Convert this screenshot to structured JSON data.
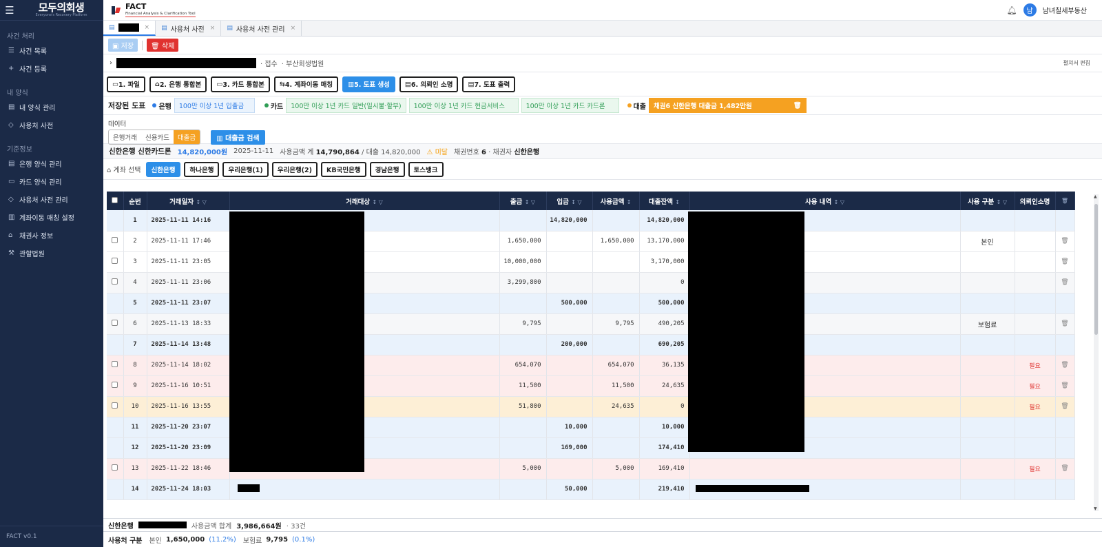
{
  "sidebar": {
    "logo_main": "모두의회생",
    "logo_sub": "Everyone's Recovery Platform",
    "sections": [
      {
        "title": "사건 처리",
        "items": [
          {
            "icon": "list-icon",
            "label": "사건 목록"
          },
          {
            "icon": "plus-icon",
            "label": "사건 등록"
          }
        ]
      },
      {
        "title": "내 양식",
        "items": [
          {
            "icon": "document-icon",
            "label": "내 양식 관리"
          },
          {
            "icon": "tag-icon",
            "label": "사용처 사전"
          }
        ]
      },
      {
        "title": "기준정보",
        "items": [
          {
            "icon": "document-icon",
            "label": "은행 양식 관리"
          },
          {
            "icon": "card-icon",
            "label": "카드 양식 관리"
          },
          {
            "icon": "tag-icon",
            "label": "사용처 사전 관리"
          },
          {
            "icon": "chart-icon",
            "label": "계좌이동 매칭 설정"
          },
          {
            "icon": "bank-icon",
            "label": "채권사 정보"
          },
          {
            "icon": "gavel-icon",
            "label": "관할법원"
          }
        ]
      }
    ],
    "version": "FACT v0.1"
  },
  "header": {
    "title": "FACT",
    "subtitle": "Financial Analysis & Clarification Tool",
    "avatar_initial": "남",
    "user_name": "남녀칠세부동산"
  },
  "tabs": [
    {
      "label": "",
      "redacted": true
    },
    {
      "label": "사용처 사전"
    },
    {
      "label": "사용처 사전 관리"
    }
  ],
  "actions": {
    "save": "저장",
    "delete": "삭제"
  },
  "case": {
    "status": "· 접수",
    "court": "· 부산회생법원",
    "edit": "펼쳐서 편집"
  },
  "steps": [
    "1. 파일",
    "2. 은행 통합본",
    "3. 카드 통합본",
    "4. 계좌이동 매칭",
    "5. 도표 생성",
    "6. 의뢰인 소명",
    "7. 도표 출력"
  ],
  "saved": {
    "label": "저장된 도표",
    "bank_label": "은행",
    "bank_chips": [
      "100만 이상 1년 입출금"
    ],
    "card_label": "카드",
    "card_chips": [
      "100만 이상 1년 카드 일반(일시불·할부)",
      "100만 이상 1년 카드 현금서비스",
      "100만 이상 1년 카드 카드론"
    ],
    "loan_label": "대출",
    "loan_chip": "채권6 신한은행 대출금 1,482만원",
    "colors": {
      "bank": "#2d7be5",
      "card": "#2f9d55",
      "loan": "#f5a121"
    }
  },
  "data_filter": {
    "label": "데이터",
    "options": [
      "은행거래",
      "신용카드",
      "대출금"
    ],
    "selected": "대출금",
    "search_button": "대출금 검색"
  },
  "summary": {
    "title": "신한은행 신한카드론",
    "amount": "14,820,000원",
    "date": "2025-11-11",
    "usage_label": "사용금액 계",
    "usage_value": "14,790,864",
    "loan_label": "/ 대출",
    "loan_value": "14,820,000",
    "warning": "미달",
    "bond_no_label": "채권번호",
    "bond_no": "6",
    "creditor_label": "· 채권자",
    "creditor": "신한은행"
  },
  "accounts": {
    "label": "계좌 선택",
    "items": [
      "신한은행",
      "하나은행",
      "우리은행(1)",
      "우리은행(2)",
      "KB국민은행",
      "경남은행",
      "토스뱅크"
    ],
    "selected": "신한은행"
  },
  "table": {
    "columns": [
      "순번",
      "거래일자",
      "거래대상",
      "출금",
      "입금",
      "사용금액",
      "대출잔액",
      "사용 내역",
      "사용 구분",
      "의뢰인소명"
    ],
    "rows": [
      {
        "no": "1",
        "date": "2025-11-11 14:16",
        "out": "",
        "in": "14,820,000",
        "used": "",
        "balance": "14,820,000",
        "cat": "",
        "need": "",
        "style": "blue",
        "check": false
      },
      {
        "no": "2",
        "date": "2025-11-11 17:46",
        "out": "1,650,000",
        "in": "",
        "used": "1,650,000",
        "balance": "13,170,000",
        "cat": "본인",
        "need": "",
        "style": "white",
        "check": true
      },
      {
        "no": "3",
        "date": "2025-11-11 23:05",
        "out": "10,000,000",
        "in": "",
        "used": "",
        "balance": "3,170,000",
        "cat": "",
        "need": "",
        "style": "white",
        "check": true
      },
      {
        "no": "4",
        "date": "2025-11-11 23:06",
        "out": "3,299,800",
        "in": "",
        "used": "",
        "balance": "0",
        "cat": "",
        "need": "",
        "style": "grey",
        "check": true
      },
      {
        "no": "5",
        "date": "2025-11-11 23:07",
        "out": "",
        "in": "500,000",
        "used": "",
        "balance": "500,000",
        "cat": "",
        "need": "",
        "style": "blue",
        "check": false
      },
      {
        "no": "6",
        "date": "2025-11-13 18:33",
        "out": "9,795",
        "in": "",
        "used": "9,795",
        "balance": "490,205",
        "cat": "보험료",
        "need": "",
        "style": "grey",
        "check": true
      },
      {
        "no": "7",
        "date": "2025-11-14 13:48",
        "out": "",
        "in": "200,000",
        "used": "",
        "balance": "690,205",
        "cat": "",
        "need": "",
        "style": "blue",
        "check": false
      },
      {
        "no": "8",
        "date": "2025-11-14 18:02",
        "out": "654,070",
        "in": "",
        "used": "654,070",
        "balance": "36,135",
        "cat": "",
        "need": "필요",
        "style": "pink",
        "check": true
      },
      {
        "no": "9",
        "date": "2025-11-16 10:51",
        "out": "11,500",
        "in": "",
        "used": "11,500",
        "balance": "24,635",
        "cat": "",
        "need": "필요",
        "style": "pink",
        "check": true
      },
      {
        "no": "10",
        "date": "2025-11-16 13:55",
        "out": "51,800",
        "in": "",
        "used": "24,635",
        "balance": "0",
        "cat": "",
        "need": "필요",
        "style": "orange",
        "check": true
      },
      {
        "no": "11",
        "date": "2025-11-20 23:07",
        "out": "",
        "in": "10,000",
        "used": "",
        "balance": "10,000",
        "cat": "",
        "need": "",
        "style": "blue",
        "check": false
      },
      {
        "no": "12",
        "date": "2025-11-20 23:09",
        "out": "",
        "in": "169,000",
        "used": "",
        "balance": "174,410",
        "cat": "",
        "need": "",
        "style": "blue",
        "check": false
      },
      {
        "no": "13",
        "date": "2025-11-22 18:46",
        "out": "5,000",
        "in": "",
        "used": "5,000",
        "balance": "169,410",
        "cat": "",
        "need": "필요",
        "style": "pink",
        "check": true
      },
      {
        "no": "14",
        "date": "2025-11-24 18:03",
        "out": "",
        "in": "50,000",
        "used": "",
        "balance": "219,410",
        "cat": "",
        "need": "",
        "style": "blue",
        "check": false
      }
    ]
  },
  "footer": {
    "bank": "신한은행",
    "usage_total_label": "사용금액 합계",
    "usage_total": "3,986,664원",
    "count": "· 33건",
    "category_label": "사용처 구분",
    "self_label": "본인",
    "self_value": "1,650,000",
    "self_pct": "(11.2%)",
    "insurance_label": "보험료",
    "insurance_value": "9,795",
    "insurance_pct": "(0.1%)"
  }
}
